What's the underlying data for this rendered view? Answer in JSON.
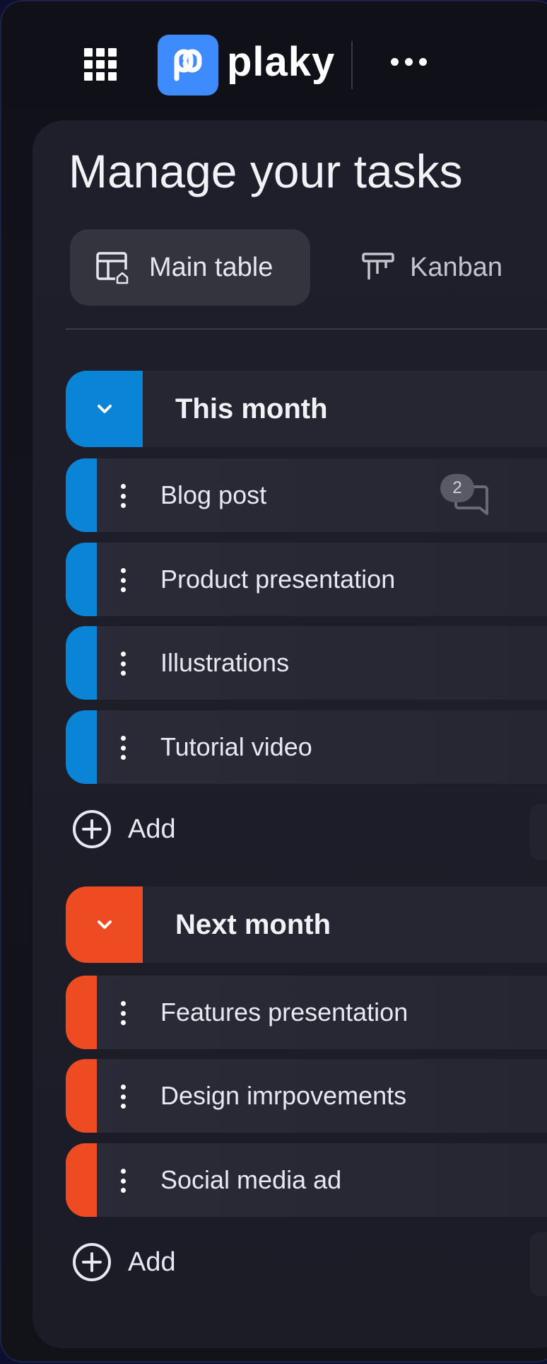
{
  "app": {
    "logo_text": "plaky"
  },
  "page": {
    "title": "Manage your tasks"
  },
  "views": [
    {
      "label": "Main table",
      "active": true
    },
    {
      "label": "Kanban",
      "active": false
    }
  ],
  "groups": [
    {
      "title": "This month",
      "color": "#0a84d6",
      "tasks": [
        {
          "name": "Blog post",
          "comments": "2"
        },
        {
          "name": "Product presentation"
        },
        {
          "name": "Illustrations"
        },
        {
          "name": "Tutorial video"
        }
      ],
      "add_label": "Add"
    },
    {
      "title": "Next month",
      "color": "#ee4b22",
      "tasks": [
        {
          "name": "Features presentation"
        },
        {
          "name": "Design imrpovements"
        },
        {
          "name": "Social media ad"
        }
      ],
      "add_label": "Add"
    }
  ],
  "icons": {
    "apps": "grid-apps-icon",
    "logo": "plaky-logo-icon",
    "more": "more-horizontal-icon",
    "main_table": "table-icon",
    "kanban": "kanban-icon",
    "collapse": "chevron-down-icon",
    "row_menu": "more-vertical-icon",
    "comment": "comment-icon",
    "add": "plus-circle-icon"
  }
}
